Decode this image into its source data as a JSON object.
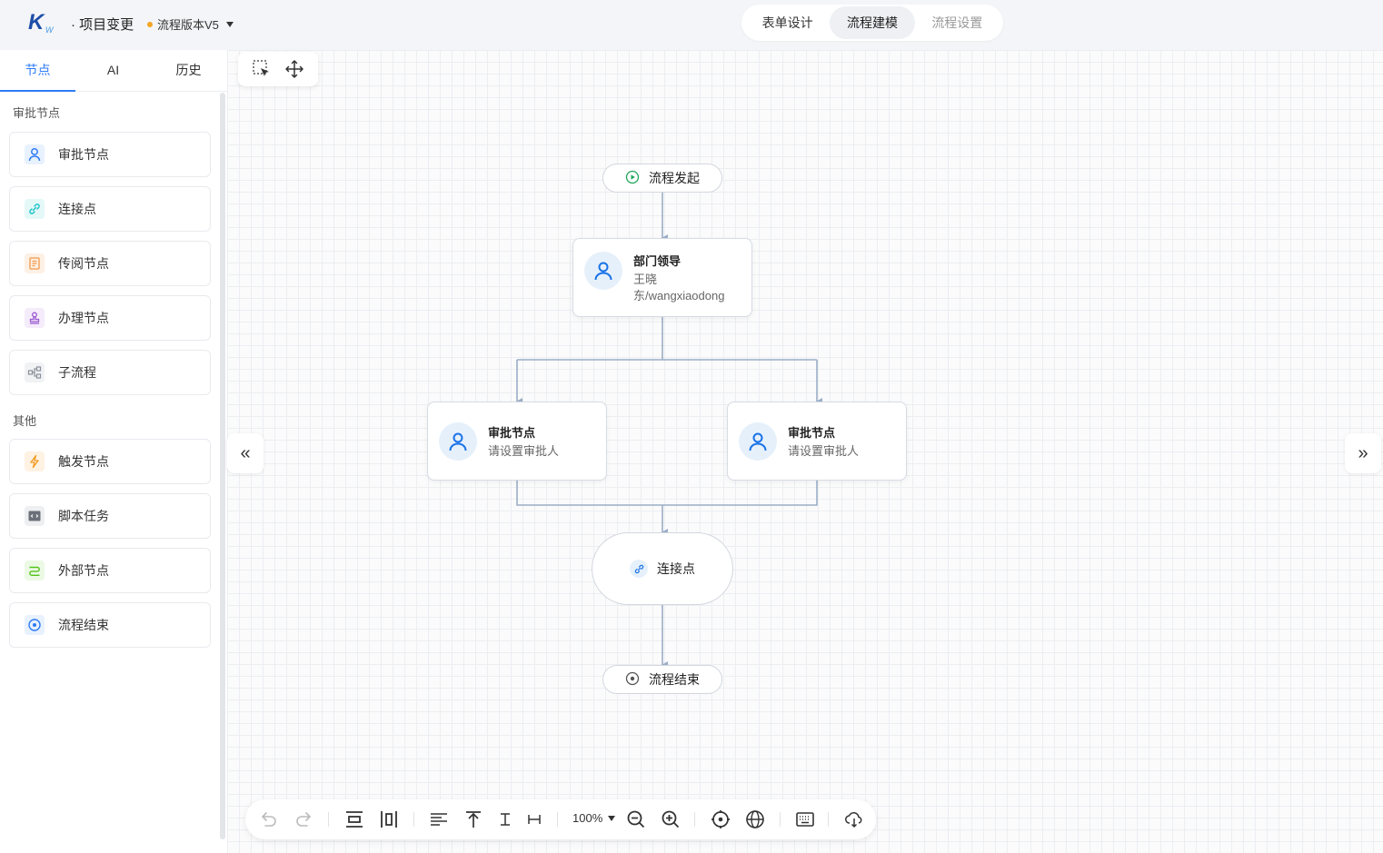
{
  "header": {
    "project_title": "· 项目变更",
    "version_label": "流程版本V5",
    "version_dot_color": "#f5a623",
    "tabs": [
      {
        "label": "表单设计",
        "state": "normal"
      },
      {
        "label": "流程建模",
        "state": "active"
      },
      {
        "label": "流程设置",
        "state": "muted"
      }
    ]
  },
  "panel": {
    "tabs": [
      {
        "label": "节点",
        "active": true
      },
      {
        "label": "AI",
        "active": false
      },
      {
        "label": "历史",
        "active": false
      }
    ],
    "sections": [
      {
        "title": "审批节点",
        "items": [
          {
            "label": "审批节点",
            "icon": "user-icon",
            "color": "#2e7cf6"
          },
          {
            "label": "连接点",
            "icon": "link-icon",
            "color": "#17c0c9"
          },
          {
            "label": "传阅节点",
            "icon": "document-icon",
            "color": "#f39a4a"
          },
          {
            "label": "办理节点",
            "icon": "stamp-icon",
            "color": "#9b59d0"
          },
          {
            "label": "子流程",
            "icon": "subflow-icon",
            "color": "#8a8f99"
          }
        ]
      },
      {
        "title": "其他",
        "items": [
          {
            "label": "触发节点",
            "icon": "lightning-icon",
            "color": "#f39a1f"
          },
          {
            "label": "脚本任务",
            "icon": "script-icon",
            "color": "#6b7079"
          },
          {
            "label": "外部节点",
            "icon": "external-icon",
            "color": "#52c41a"
          },
          {
            "label": "流程结束",
            "icon": "end-icon",
            "color": "#2e7cf6"
          }
        ]
      }
    ]
  },
  "flow": {
    "start": {
      "label": "流程发起",
      "icon": "play-icon"
    },
    "dept_leader": {
      "title": "部门领导",
      "line1": "王晓",
      "line2": "东/wangxiaodong"
    },
    "approve_left": {
      "title": "审批节点",
      "subtitle": "请设置审批人"
    },
    "approve_right": {
      "title": "审批节点",
      "subtitle": "请设置审批人"
    },
    "connector": {
      "label": "连接点"
    },
    "end": {
      "label": "流程结束"
    }
  },
  "toolbar": {
    "zoom": "100%"
  },
  "colors": {
    "accent": "#2e7cf6",
    "edge": "#9aaec6"
  }
}
